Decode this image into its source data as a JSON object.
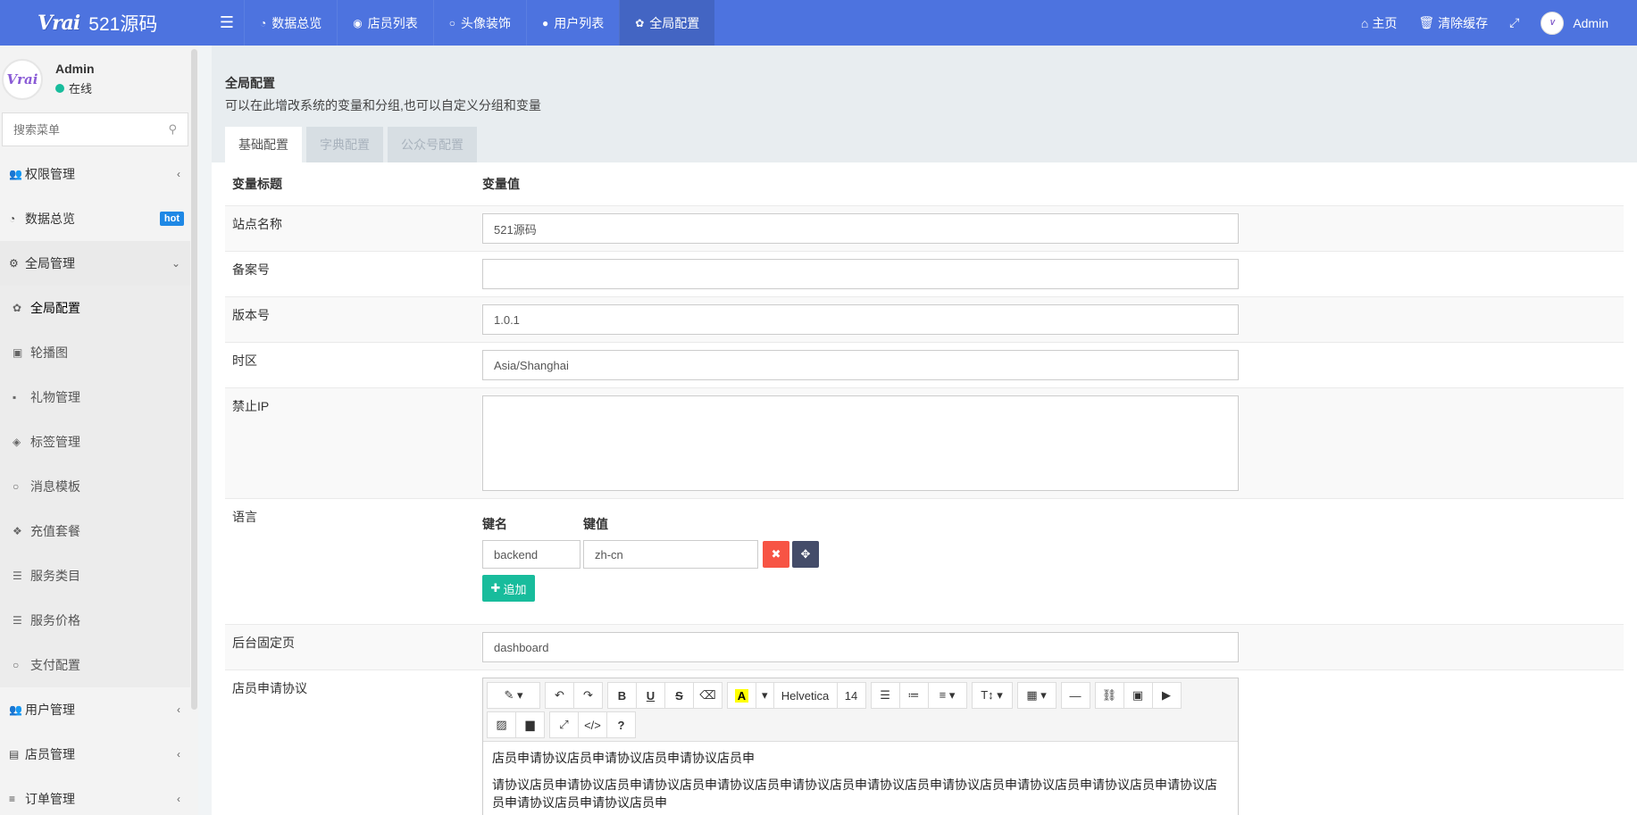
{
  "topbar": {
    "logo_mark": "Vrai",
    "logo_text": "521源码",
    "tabs": [
      {
        "label": "数据总览",
        "icon": "dashboard-icon",
        "glyph": "◔"
      },
      {
        "label": "店员列表",
        "icon": "user-circle-icon",
        "glyph": "◉"
      },
      {
        "label": "头像装饰",
        "icon": "circle-icon",
        "glyph": "○"
      },
      {
        "label": "用户列表",
        "icon": "user-icon",
        "glyph": "●"
      },
      {
        "label": "全局配置",
        "icon": "gear-icon",
        "glyph": "✿"
      }
    ],
    "home_label": "主页",
    "clear_cache_label": "清除缓存",
    "admin_label": "Admin"
  },
  "sidebar": {
    "user_name": "Admin",
    "user_status": "在线",
    "search_placeholder": "搜索菜单",
    "menu": {
      "auth": "权限管理",
      "dashboard": "数据总览",
      "dashboard_badge": "hot",
      "global": "全局管理",
      "global_children": [
        "全局配置",
        "轮播图",
        "礼物管理",
        "标签管理",
        "消息模板",
        "充值套餐",
        "服务类目",
        "服务价格",
        "支付配置"
      ],
      "user_mgmt": "用户管理",
      "staff_mgmt": "店员管理",
      "order_mgmt": "订单管理"
    }
  },
  "content": {
    "title": "全局配置",
    "description": "可以在此增改系统的变量和分组,也可以自定义分组和变量",
    "tabs": [
      "基础配置",
      "字典配置",
      "公众号配置"
    ],
    "table_head": {
      "key": "变量标题",
      "value": "变量值"
    },
    "rows": {
      "site_name": {
        "label": "站点名称",
        "value": "521源码"
      },
      "beian": {
        "label": "备案号",
        "value": ""
      },
      "version": {
        "label": "版本号",
        "value": "1.0.1"
      },
      "timezone": {
        "label": "时区",
        "value": "Asia/Shanghai"
      },
      "forbid_ip": {
        "label": "禁止IP",
        "value": ""
      },
      "language": {
        "label": "语言",
        "col_key": "键名",
        "col_value": "键值",
        "key": "backend",
        "value": "zh-cn",
        "add_label": "追加"
      },
      "fixed_page": {
        "label": "后台固定页",
        "value": "dashboard"
      },
      "agreement": {
        "label": "店员申请协议",
        "toolbar": {
          "font": "Helvetica",
          "size": "14"
        },
        "para1": "店员申请协议店员申请协议店员申请协议店员申",
        "para2": "请协议店员申请协议店员申请协议店员申请协议店员申请协议店员申请协议店员申请协议店员申请协议店员申请协议店员申请协议店员申请协议店员申请协议店员申"
      }
    }
  }
}
